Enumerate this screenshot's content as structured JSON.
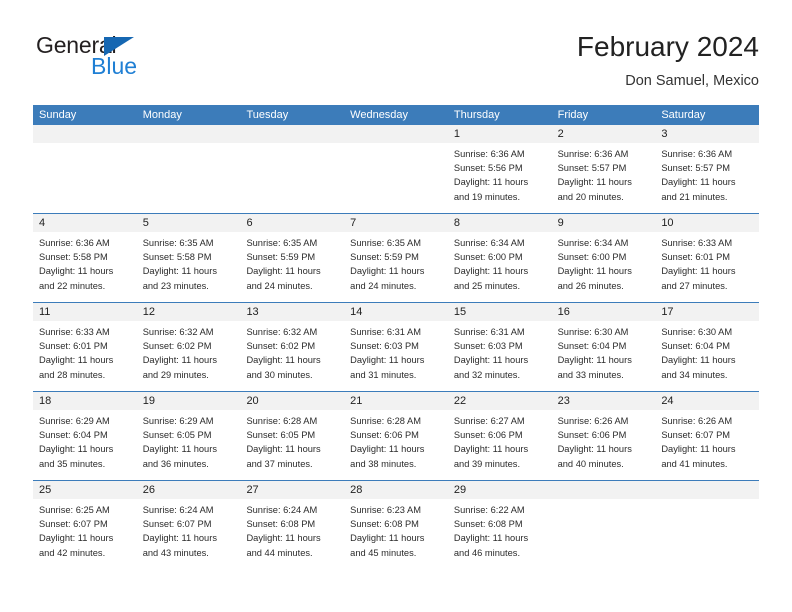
{
  "brand": {
    "name_dark": "General",
    "name_blue": "Blue",
    "accent_blue": "#1f7fd4",
    "triangle_blue": "#1667b2"
  },
  "header": {
    "month_title": "February 2024",
    "location": "Don Samuel, Mexico"
  },
  "calendar": {
    "header_bg": "#3c7cba",
    "daynum_bg": "#f2f2f2",
    "weekdays": [
      "Sunday",
      "Monday",
      "Tuesday",
      "Wednesday",
      "Thursday",
      "Friday",
      "Saturday"
    ],
    "weeks": [
      [
        {
          "day": "",
          "sunrise": "",
          "sunset": "",
          "daylight_line1": "",
          "daylight_line2": ""
        },
        {
          "day": "",
          "sunrise": "",
          "sunset": "",
          "daylight_line1": "",
          "daylight_line2": ""
        },
        {
          "day": "",
          "sunrise": "",
          "sunset": "",
          "daylight_line1": "",
          "daylight_line2": ""
        },
        {
          "day": "",
          "sunrise": "",
          "sunset": "",
          "daylight_line1": "",
          "daylight_line2": ""
        },
        {
          "day": "1",
          "sunrise": "Sunrise: 6:36 AM",
          "sunset": "Sunset: 5:56 PM",
          "daylight_line1": "Daylight: 11 hours",
          "daylight_line2": "and 19 minutes."
        },
        {
          "day": "2",
          "sunrise": "Sunrise: 6:36 AM",
          "sunset": "Sunset: 5:57 PM",
          "daylight_line1": "Daylight: 11 hours",
          "daylight_line2": "and 20 minutes."
        },
        {
          "day": "3",
          "sunrise": "Sunrise: 6:36 AM",
          "sunset": "Sunset: 5:57 PM",
          "daylight_line1": "Daylight: 11 hours",
          "daylight_line2": "and 21 minutes."
        }
      ],
      [
        {
          "day": "4",
          "sunrise": "Sunrise: 6:36 AM",
          "sunset": "Sunset: 5:58 PM",
          "daylight_line1": "Daylight: 11 hours",
          "daylight_line2": "and 22 minutes."
        },
        {
          "day": "5",
          "sunrise": "Sunrise: 6:35 AM",
          "sunset": "Sunset: 5:58 PM",
          "daylight_line1": "Daylight: 11 hours",
          "daylight_line2": "and 23 minutes."
        },
        {
          "day": "6",
          "sunrise": "Sunrise: 6:35 AM",
          "sunset": "Sunset: 5:59 PM",
          "daylight_line1": "Daylight: 11 hours",
          "daylight_line2": "and 24 minutes."
        },
        {
          "day": "7",
          "sunrise": "Sunrise: 6:35 AM",
          "sunset": "Sunset: 5:59 PM",
          "daylight_line1": "Daylight: 11 hours",
          "daylight_line2": "and 24 minutes."
        },
        {
          "day": "8",
          "sunrise": "Sunrise: 6:34 AM",
          "sunset": "Sunset: 6:00 PM",
          "daylight_line1": "Daylight: 11 hours",
          "daylight_line2": "and 25 minutes."
        },
        {
          "day": "9",
          "sunrise": "Sunrise: 6:34 AM",
          "sunset": "Sunset: 6:00 PM",
          "daylight_line1": "Daylight: 11 hours",
          "daylight_line2": "and 26 minutes."
        },
        {
          "day": "10",
          "sunrise": "Sunrise: 6:33 AM",
          "sunset": "Sunset: 6:01 PM",
          "daylight_line1": "Daylight: 11 hours",
          "daylight_line2": "and 27 minutes."
        }
      ],
      [
        {
          "day": "11",
          "sunrise": "Sunrise: 6:33 AM",
          "sunset": "Sunset: 6:01 PM",
          "daylight_line1": "Daylight: 11 hours",
          "daylight_line2": "and 28 minutes."
        },
        {
          "day": "12",
          "sunrise": "Sunrise: 6:32 AM",
          "sunset": "Sunset: 6:02 PM",
          "daylight_line1": "Daylight: 11 hours",
          "daylight_line2": "and 29 minutes."
        },
        {
          "day": "13",
          "sunrise": "Sunrise: 6:32 AM",
          "sunset": "Sunset: 6:02 PM",
          "daylight_line1": "Daylight: 11 hours",
          "daylight_line2": "and 30 minutes."
        },
        {
          "day": "14",
          "sunrise": "Sunrise: 6:31 AM",
          "sunset": "Sunset: 6:03 PM",
          "daylight_line1": "Daylight: 11 hours",
          "daylight_line2": "and 31 minutes."
        },
        {
          "day": "15",
          "sunrise": "Sunrise: 6:31 AM",
          "sunset": "Sunset: 6:03 PM",
          "daylight_line1": "Daylight: 11 hours",
          "daylight_line2": "and 32 minutes."
        },
        {
          "day": "16",
          "sunrise": "Sunrise: 6:30 AM",
          "sunset": "Sunset: 6:04 PM",
          "daylight_line1": "Daylight: 11 hours",
          "daylight_line2": "and 33 minutes."
        },
        {
          "day": "17",
          "sunrise": "Sunrise: 6:30 AM",
          "sunset": "Sunset: 6:04 PM",
          "daylight_line1": "Daylight: 11 hours",
          "daylight_line2": "and 34 minutes."
        }
      ],
      [
        {
          "day": "18",
          "sunrise": "Sunrise: 6:29 AM",
          "sunset": "Sunset: 6:04 PM",
          "daylight_line1": "Daylight: 11 hours",
          "daylight_line2": "and 35 minutes."
        },
        {
          "day": "19",
          "sunrise": "Sunrise: 6:29 AM",
          "sunset": "Sunset: 6:05 PM",
          "daylight_line1": "Daylight: 11 hours",
          "daylight_line2": "and 36 minutes."
        },
        {
          "day": "20",
          "sunrise": "Sunrise: 6:28 AM",
          "sunset": "Sunset: 6:05 PM",
          "daylight_line1": "Daylight: 11 hours",
          "daylight_line2": "and 37 minutes."
        },
        {
          "day": "21",
          "sunrise": "Sunrise: 6:28 AM",
          "sunset": "Sunset: 6:06 PM",
          "daylight_line1": "Daylight: 11 hours",
          "daylight_line2": "and 38 minutes."
        },
        {
          "day": "22",
          "sunrise": "Sunrise: 6:27 AM",
          "sunset": "Sunset: 6:06 PM",
          "daylight_line1": "Daylight: 11 hours",
          "daylight_line2": "and 39 minutes."
        },
        {
          "day": "23",
          "sunrise": "Sunrise: 6:26 AM",
          "sunset": "Sunset: 6:06 PM",
          "daylight_line1": "Daylight: 11 hours",
          "daylight_line2": "and 40 minutes."
        },
        {
          "day": "24",
          "sunrise": "Sunrise: 6:26 AM",
          "sunset": "Sunset: 6:07 PM",
          "daylight_line1": "Daylight: 11 hours",
          "daylight_line2": "and 41 minutes."
        }
      ],
      [
        {
          "day": "25",
          "sunrise": "Sunrise: 6:25 AM",
          "sunset": "Sunset: 6:07 PM",
          "daylight_line1": "Daylight: 11 hours",
          "daylight_line2": "and 42 minutes."
        },
        {
          "day": "26",
          "sunrise": "Sunrise: 6:24 AM",
          "sunset": "Sunset: 6:07 PM",
          "daylight_line1": "Daylight: 11 hours",
          "daylight_line2": "and 43 minutes."
        },
        {
          "day": "27",
          "sunrise": "Sunrise: 6:24 AM",
          "sunset": "Sunset: 6:08 PM",
          "daylight_line1": "Daylight: 11 hours",
          "daylight_line2": "and 44 minutes."
        },
        {
          "day": "28",
          "sunrise": "Sunrise: 6:23 AM",
          "sunset": "Sunset: 6:08 PM",
          "daylight_line1": "Daylight: 11 hours",
          "daylight_line2": "and 45 minutes."
        },
        {
          "day": "29",
          "sunrise": "Sunrise: 6:22 AM",
          "sunset": "Sunset: 6:08 PM",
          "daylight_line1": "Daylight: 11 hours",
          "daylight_line2": "and 46 minutes."
        },
        {
          "day": "",
          "sunrise": "",
          "sunset": "",
          "daylight_line1": "",
          "daylight_line2": ""
        },
        {
          "day": "",
          "sunrise": "",
          "sunset": "",
          "daylight_line1": "",
          "daylight_line2": ""
        }
      ]
    ]
  }
}
